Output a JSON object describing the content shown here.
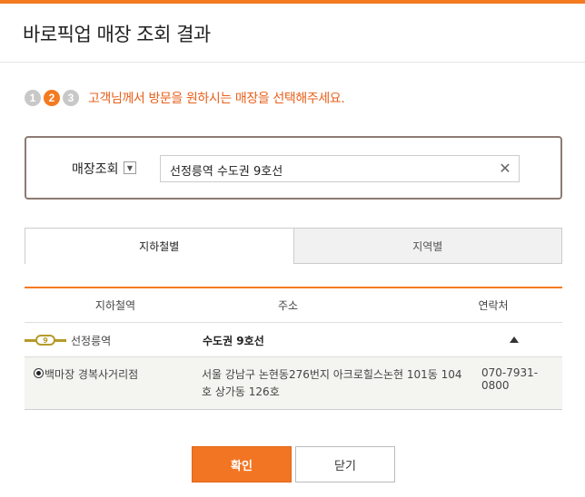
{
  "header": {
    "title": "바로픽업 매장 조회 결과"
  },
  "steps": {
    "items": [
      "1",
      "2",
      "3"
    ],
    "active_index": 1,
    "message": "고객님께서 방문을 원하시는 매장을 선택해주세요."
  },
  "search": {
    "label": "매장조회",
    "dropdown_icon": "chevron-down-icon",
    "value": "선정릉역 수도권 9호선",
    "clear_icon": "close-icon"
  },
  "tabs": [
    {
      "label": "지하철별",
      "active": true
    },
    {
      "label": "지역별",
      "active": false
    }
  ],
  "table": {
    "headers": [
      "지하철역",
      "주소",
      "연락처"
    ],
    "line": {
      "number": "9",
      "station": "선정릉역",
      "line_name": "수도권 9호선",
      "color": "#b59a2a"
    },
    "stores": [
      {
        "name": "백마장 경복사거리점",
        "address": "서울 강남구 논현동276번지 아크로힐스논현 101동 104호 상가동 126호",
        "phone": "070-7931-0800",
        "selected": true
      }
    ]
  },
  "buttons": {
    "confirm": "확인",
    "close": "닫기"
  },
  "colors": {
    "accent": "#f47a20"
  }
}
